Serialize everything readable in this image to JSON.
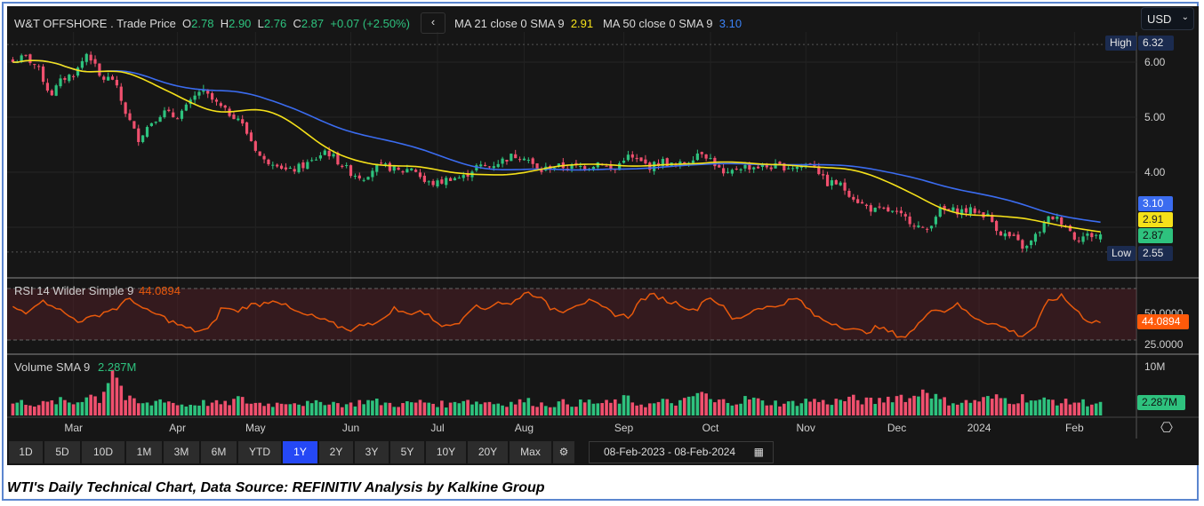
{
  "header": {
    "instrument": "W&T OFFSHORE",
    "series": ". Trade Price",
    "o_label": "O",
    "o": "2.78",
    "h_label": "H",
    "h": "2.90",
    "l_label": "L",
    "l": "2.76",
    "c_label": "C",
    "c": "2.87",
    "change": "+0.07 (+2.50%)",
    "back": "‹",
    "ma21_label": "MA 21 close 0 SMA 9",
    "ma21": "2.91",
    "ma50_label": "MA 50 close 0 SMA 9",
    "ma50": "3.10"
  },
  "currency": {
    "value": "USD",
    "chevron": "⌄"
  },
  "price_axis": {
    "ticks": [
      "6.00",
      "5.00",
      "4.00"
    ],
    "high_label": "High",
    "high": "6.32",
    "low_label": "Low",
    "low": "2.55",
    "ma50_tag": "3.10",
    "ma21_tag": "2.91",
    "last_tag": "2.87"
  },
  "rsi": {
    "label": "RSI 14 Wilder Simple 9",
    "value": "44.0894",
    "ticks": [
      "50.0000",
      "25.0000"
    ]
  },
  "volume": {
    "label": "Volume SMA 9",
    "value": "2.287M",
    "tick": "10M",
    "tag": "2.287M"
  },
  "months": [
    {
      "label": "Mar",
      "day": 14
    },
    {
      "label": "Apr",
      "day": 38
    },
    {
      "label": "May",
      "day": 56
    },
    {
      "label": "Jun",
      "day": 78
    },
    {
      "label": "Jul",
      "day": 98
    },
    {
      "label": "Aug",
      "day": 118
    },
    {
      "label": "Sep",
      "day": 141
    },
    {
      "label": "Oct",
      "day": 161
    },
    {
      "label": "Nov",
      "day": 183
    },
    {
      "label": "Dec",
      "day": 204
    },
    {
      "label": "2024",
      "day": 223
    },
    {
      "label": "Feb",
      "day": 245
    }
  ],
  "ranges": [
    "1D",
    "5D",
    "10D",
    "1M",
    "3M",
    "6M",
    "YTD",
    "1Y",
    "2Y",
    "3Y",
    "5Y",
    "10Y",
    "20Y",
    "Max"
  ],
  "active_range": "1Y",
  "date_range": "08-Feb-2023  -  08-Feb-2024",
  "caption": "WTI's Daily Technical Chart, Data Source: REFINITIV  Analysis by Kalkine Group",
  "colors": {
    "up": "#2ec27e",
    "down": "#f0506e",
    "ma21": "#f5e11a",
    "ma50": "#3b6cf0",
    "rsi": "#e8590c",
    "rsi_tag": "#ff5a0a",
    "last_tag": "#2ec27e",
    "hl_tag": "#1b2b4f"
  },
  "chart_data": {
    "type": "candlestick",
    "title": "W&T OFFSHORE . Trade Price",
    "trading_days": 252,
    "ylim": [
      2.4,
      6.45
    ],
    "close_keypoints": [
      6.0,
      6.1,
      5.9,
      5.4,
      5.7,
      5.8,
      6.2,
      5.7,
      5.7,
      5.1,
      4.6,
      4.9,
      5.1,
      5.0,
      5.2,
      5.5,
      5.3,
      5.1,
      5.0,
      4.6,
      4.2,
      4.2,
      4.0,
      4.1,
      4.2,
      4.4,
      4.2,
      4.0,
      3.9,
      4.1,
      4.1,
      4.0,
      4.1,
      3.8,
      3.8,
      3.9,
      3.9,
      4.1,
      4.1,
      4.2,
      4.3,
      4.3,
      4.0,
      4.1,
      4.1,
      4.1,
      4.1,
      4.2,
      4.0,
      4.3,
      4.2,
      4.1,
      4.2,
      4.1,
      4.2,
      4.4,
      4.2,
      3.9,
      4.1,
      4.1,
      4.1,
      4.1,
      4.1,
      4.1,
      4.2,
      3.8,
      3.8,
      3.6,
      3.4,
      3.3,
      3.3,
      3.2,
      3.1,
      2.9,
      3.3,
      3.3,
      3.3,
      3.3,
      3.2,
      2.9,
      2.8,
      2.6,
      2.9,
      3.2,
      3.1,
      2.8,
      2.85,
      2.87
    ],
    "rsi_keypoints": [
      55,
      52,
      60,
      58,
      50,
      45,
      47,
      52,
      55,
      63,
      53,
      50,
      45,
      40,
      37,
      38,
      56,
      52,
      57,
      58,
      62,
      55,
      50,
      48,
      44,
      40,
      38,
      44,
      43,
      55,
      50,
      53,
      47,
      40,
      44,
      56,
      54,
      60,
      57,
      67,
      65,
      55,
      53,
      58,
      60,
      55,
      50,
      48,
      62,
      65,
      60,
      58,
      52,
      64,
      58,
      45,
      50,
      56,
      55,
      60,
      62,
      50,
      45,
      42,
      38,
      36,
      40,
      36,
      32,
      40,
      55,
      52,
      58,
      50,
      45,
      42,
      38,
      33,
      40,
      60,
      64,
      55,
      45,
      44
    ],
    "rsi_range": [
      20,
      75
    ],
    "volume_keypoints_M": [
      2.4,
      2.8,
      2.2,
      2.6,
      3.0,
      2.4,
      4.5,
      3.2,
      10.5,
      3.5,
      2.5,
      2.2,
      3.6,
      2.3,
      2.1,
      2.6,
      2.5,
      2.3,
      3.4,
      2.6,
      2.4,
      2.3,
      3.0,
      2.6,
      2.2,
      3.0,
      2.4,
      2.2,
      3.0,
      2.8,
      2.4,
      2.2,
      2.6,
      2.8,
      2.4,
      2.2,
      3.6,
      2.6,
      2.8,
      2.4,
      2.6,
      3.0,
      2.4,
      2.2,
      2.6,
      2.4,
      2.8,
      2.4,
      2.6,
      3.4,
      2.4,
      2.2,
      2.8,
      2.6,
      3.0,
      5.0,
      2.6,
      3.0,
      2.8,
      3.6,
      2.6,
      2.6,
      2.4,
      2.8,
      3.2,
      2.6,
      3.0,
      3.4,
      3.0,
      2.8,
      3.6,
      4.0,
      3.4,
      6.0,
      3.2,
      2.8,
      2.6,
      3.0,
      3.4,
      3.6,
      3.0,
      3.8,
      2.8,
      3.2,
      2.6,
      2.8,
      2.6,
      2.5
    ],
    "volume_max_M": 12
  }
}
